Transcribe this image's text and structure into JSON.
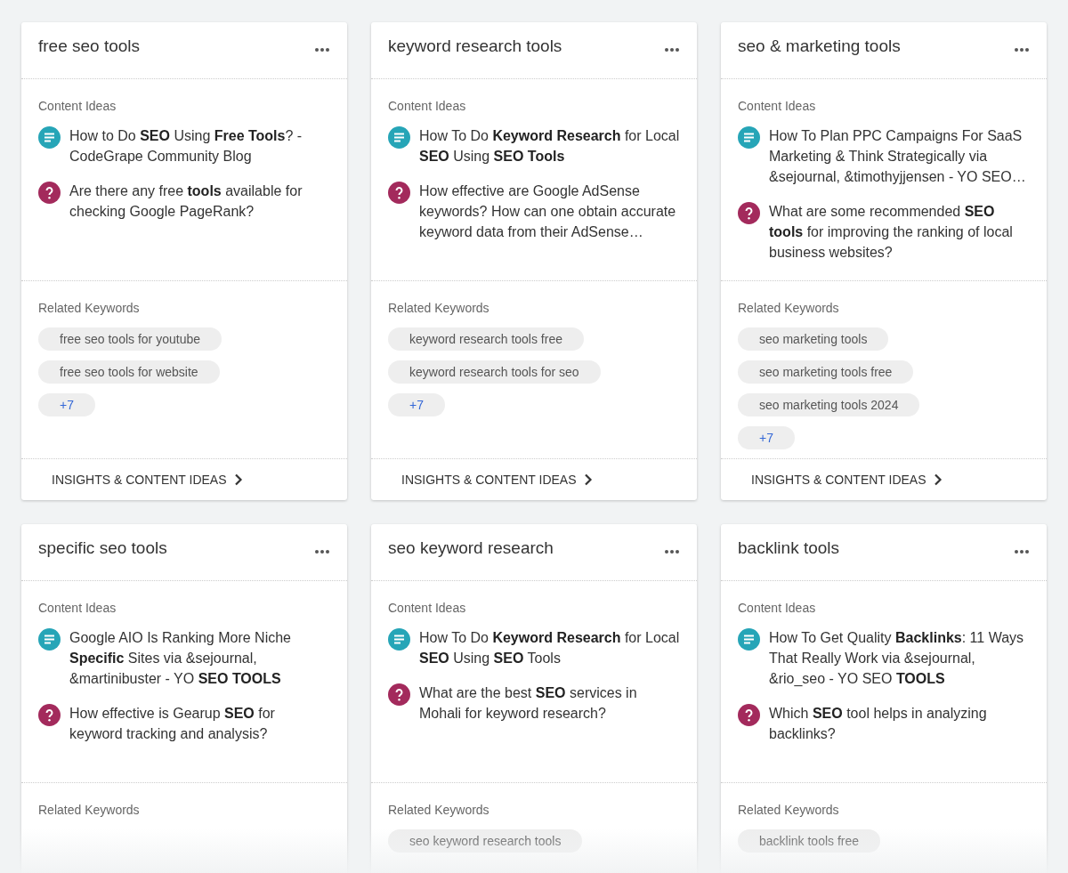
{
  "cards": [
    {
      "title": "free seo tools",
      "content_ideas_label": "Content Ideas",
      "ideas": [
        {
          "kind": "article",
          "text": "How to Do **SEO** Using **Free Tools**? - CodeGrape Community Blog"
        },
        {
          "kind": "question",
          "text": "Are there any free **tools** available for checking Google PageRank?"
        }
      ],
      "related_label": "Related Keywords",
      "keywords": [
        "free seo tools for youtube",
        "free seo tools for website"
      ],
      "more": "+7",
      "footer": "INSIGHTS & CONTENT IDEAS"
    },
    {
      "title": "keyword research tools",
      "content_ideas_label": "Content Ideas",
      "ideas": [
        {
          "kind": "article",
          "text": "How To Do **Keyword Research** for Local **SEO** Using **SEO** **Tools**"
        },
        {
          "kind": "question",
          "text": "How effective are Google AdSense keywords? How can one obtain accurate keyword data from their AdSense…"
        }
      ],
      "related_label": "Related Keywords",
      "keywords": [
        "keyword research tools free",
        "keyword research tools for seo"
      ],
      "more": "+7",
      "footer": "INSIGHTS & CONTENT IDEAS"
    },
    {
      "title": "seo & marketing tools",
      "content_ideas_label": "Content Ideas",
      "ideas": [
        {
          "kind": "article",
          "text": "How To Plan PPC Campaigns For SaaS Marketing & Think Strategically via &sejournal, &timothyjjensen - YO SEO…"
        },
        {
          "kind": "question",
          "text": "What are some recommended **SEO tools** for improving the ranking of local business websites?"
        }
      ],
      "related_label": "Related Keywords",
      "keywords": [
        "seo marketing tools",
        "seo marketing tools free",
        "seo marketing tools 2024"
      ],
      "more": "+7",
      "footer": "INSIGHTS & CONTENT IDEAS"
    },
    {
      "title": "specific seo tools",
      "content_ideas_label": "Content Ideas",
      "ideas": [
        {
          "kind": "article",
          "text": "Google AIO Is Ranking More Niche **Specific** Sites via &sejournal, &martinibuster - YO **SEO TOOLS**"
        },
        {
          "kind": "question",
          "text": "How effective is Gearup **SEO** for keyword tracking and analysis?"
        }
      ],
      "related_label": "Related Keywords"
    },
    {
      "title": "seo keyword research",
      "content_ideas_label": "Content Ideas",
      "ideas": [
        {
          "kind": "article",
          "text": "How To Do **Keyword Research** for Local **SEO** Using **SEO** Tools"
        },
        {
          "kind": "question",
          "text": "What are the best **SEO** services in Mohali for keyword research?"
        }
      ],
      "related_label": "Related Keywords",
      "keywords": [
        "seo keyword research tools"
      ]
    },
    {
      "title": "backlink tools",
      "content_ideas_label": "Content Ideas",
      "ideas": [
        {
          "kind": "article",
          "text": "How To Get Quality **Backlinks**: 11 Ways That Really Work via &sejournal, &rio_seo - YO SEO **TOOLS**"
        },
        {
          "kind": "question",
          "text": "Which **SEO** tool helps in analyzing backlinks?"
        }
      ],
      "related_label": "Related Keywords",
      "keywords": [
        "backlink tools free"
      ]
    }
  ]
}
